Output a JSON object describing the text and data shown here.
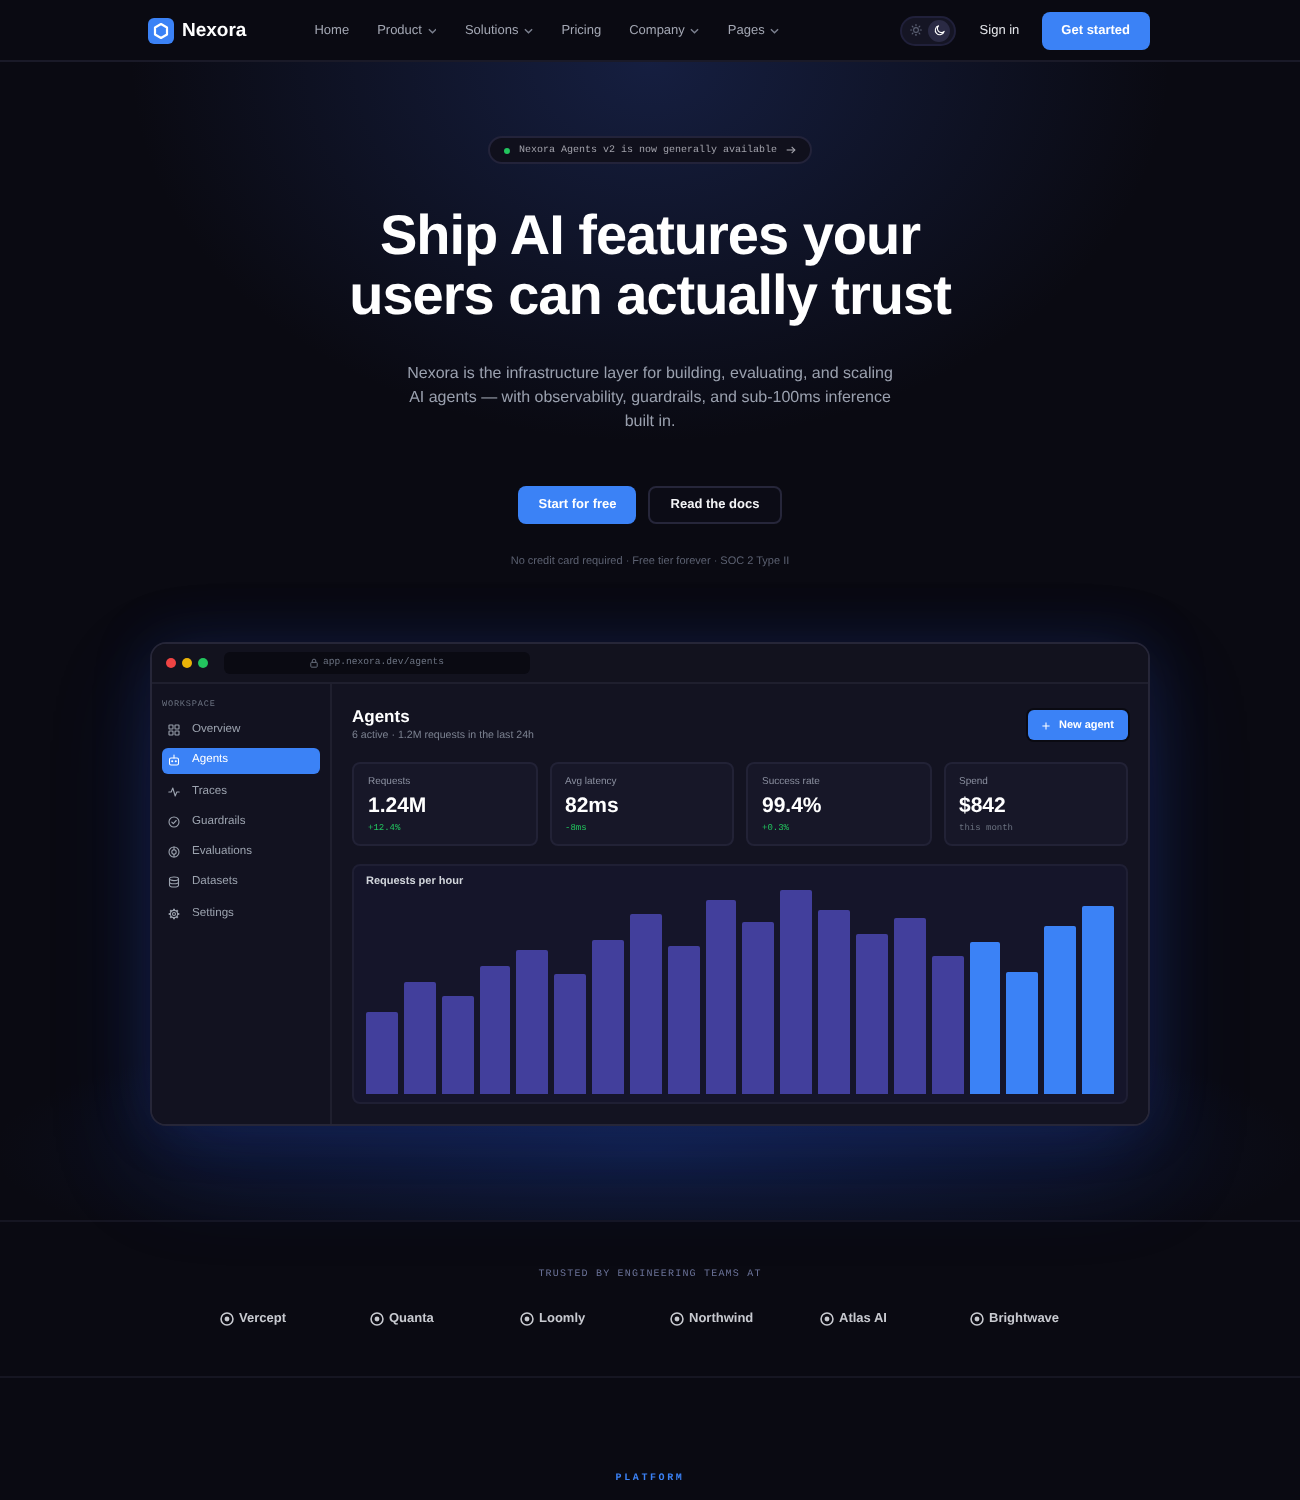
{
  "nav": {
    "brand": "Nexora",
    "links": [
      {
        "label": "Home",
        "has_menu": false
      },
      {
        "label": "Product",
        "has_menu": true
      },
      {
        "label": "Solutions",
        "has_menu": true
      },
      {
        "label": "Pricing",
        "has_menu": false
      },
      {
        "label": "Company",
        "has_menu": true
      },
      {
        "label": "Pages",
        "has_menu": true
      }
    ],
    "theme_toggle": [
      {
        "kind": "sun",
        "selected": false
      },
      {
        "kind": "moon",
        "selected": true
      }
    ],
    "sign_in": "Sign in",
    "cta": "Get started"
  },
  "hero": {
    "badge": "Nexora Agents v2 is now generally available",
    "title": "Ship AI features your users can actually trust",
    "description": "Nexora is the infrastructure layer for building, evaluating, and scaling AI agents — with observability, guardrails, and sub-100ms inference built in.",
    "buttons": [
      {
        "label": "Start for free",
        "kind": "primary"
      },
      {
        "label": "Read the docs",
        "kind": "secondary"
      }
    ],
    "fine_print": "No credit card required · Free tier forever · SOC 2 Type II"
  },
  "app_preview": {
    "url": "app.nexora.dev/agents",
    "sidebar": {
      "section": "WORKSPACE",
      "items": [
        {
          "label": "Overview",
          "selected": false
        },
        {
          "label": "Agents",
          "selected": true
        },
        {
          "label": "Traces",
          "selected": false
        },
        {
          "label": "Guardrails",
          "selected": false
        },
        {
          "label": "Evaluations",
          "selected": false
        },
        {
          "label": "Datasets",
          "selected": false
        },
        {
          "label": "Settings",
          "selected": false
        }
      ]
    },
    "header": {
      "title": "Agents",
      "subtitle": "6 active · 1.2M requests in the last 24h",
      "button": "New agent"
    },
    "stats": [
      {
        "label": "Requests",
        "value": "1.24M",
        "note": "+12.4%",
        "positive": true
      },
      {
        "label": "Avg latency",
        "value": "82ms",
        "note": "-8ms",
        "positive": true
      },
      {
        "label": "Success rate",
        "value": "99.4%",
        "note": "+0.3%",
        "positive": true
      },
      {
        "label": "Spend",
        "value": "$842",
        "note": "this month",
        "positive": false
      }
    ],
    "chart": {
      "title": "Requests per hour"
    }
  },
  "logos": {
    "heading": "TRUSTED BY ENGINEERING TEAMS AT",
    "companies": [
      "Vercept",
      "Quanta",
      "Loomly",
      "Northwind",
      "Atlas AI",
      "Brightwave"
    ]
  },
  "next_section": {
    "eyebrow": "PLATFORM"
  }
}
